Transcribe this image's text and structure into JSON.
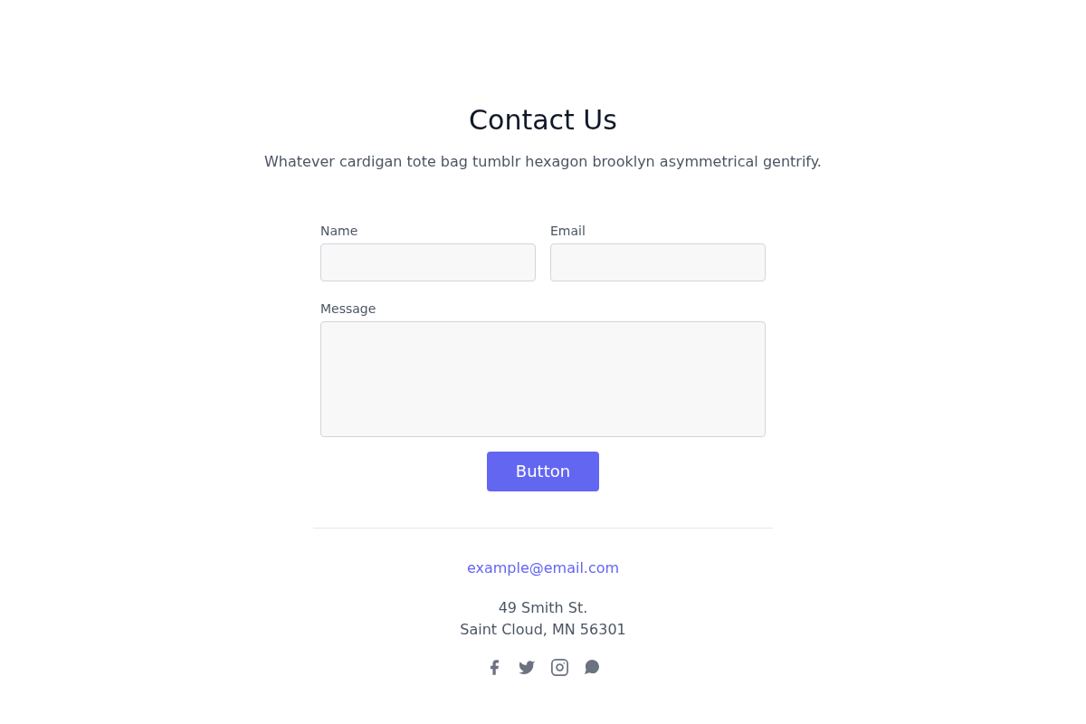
{
  "header": {
    "title": "Contact Us",
    "subtitle": "Whatever cardigan tote bag tumblr hexagon brooklyn asymmetrical gentrify."
  },
  "form": {
    "fields": [
      {
        "kind": "input",
        "label": "Name"
      },
      {
        "kind": "input",
        "label": "Email"
      },
      {
        "kind": "textarea",
        "label": "Message"
      }
    ],
    "submit": "Button"
  },
  "footer": {
    "email": "example@email.com",
    "address": [
      "49 Smith St.",
      "Saint Cloud, MN 56301"
    ],
    "social": [
      {
        "kind": "facebook"
      },
      {
        "kind": "twitter"
      },
      {
        "kind": "instagram"
      },
      {
        "kind": "chat"
      }
    ]
  }
}
